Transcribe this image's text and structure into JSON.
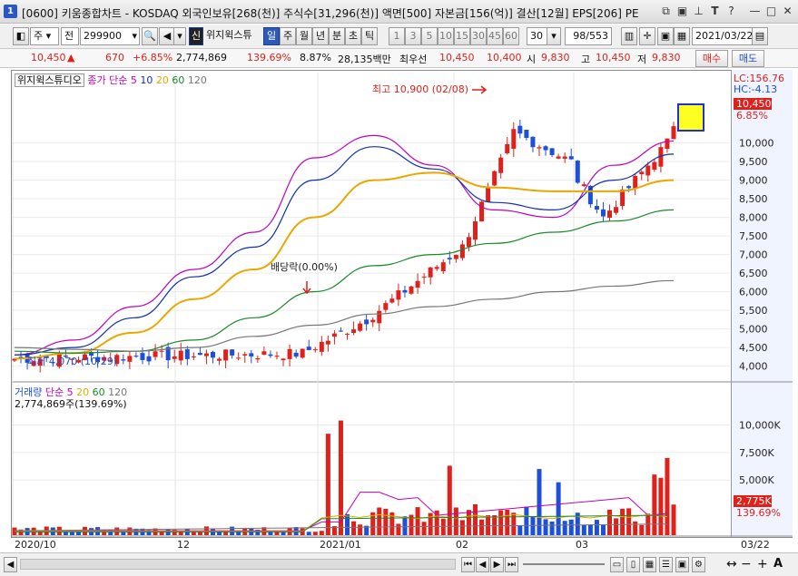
{
  "window": {
    "title": "[0600] 키움종합차트 - KOSDAQ 외국인보유[268(천)] 주식수[31,296(천)] 액면[500] 자본금[156(억)] 결산[12월] EPS[206] PE",
    "icon_label": "1"
  },
  "toolbar": {
    "type1": "주",
    "type2": "전",
    "code": "299900",
    "stock_name": "위지윅스튜",
    "credit_badge": "신",
    "periods": [
      "일",
      "주",
      "월",
      "년",
      "분",
      "초",
      "틱"
    ],
    "active_period": "일",
    "intervals": [
      "1",
      "3",
      "5",
      "10",
      "15",
      "30",
      "45",
      "60"
    ],
    "interval_value": "30",
    "page_count": "98/553",
    "date": "2021/03/22"
  },
  "quote": {
    "price": "10,450",
    "change": "670",
    "change_pct": "+6.85%",
    "volume": "2,774,869",
    "volume_ratio": "139.69%",
    "turnover": "8.87%",
    "trade_value": "28,135백만",
    "best_ask_label": "최우선",
    "best_ask": "10,450",
    "best_bid": "10,400",
    "open_label": "시",
    "open": "9,830",
    "high_label": "고",
    "high": "10,450",
    "low_label": "저",
    "low": "9,830",
    "buy_label": "매수",
    "sell_label": "매도"
  },
  "price_panel": {
    "legend_name": "위지윅스튜디오",
    "legend_ma_label": "종가 단순",
    "legend_periods": [
      "5",
      "10",
      "20",
      "60",
      "120"
    ],
    "lc": "LC:156.76",
    "hc": "HC:-4.13",
    "current_price_tag": "10,450",
    "current_pct_tag": "6.85%",
    "annot_high": "최고 10,900 (02/08)",
    "annot_low": "최저 4,070 (10/29)",
    "annot_dividend": "배당락(0.00%)"
  },
  "volume_panel": {
    "legend_name": "거래량",
    "legend_ma_label": "단순",
    "legend_periods": [
      "5",
      "20",
      "60",
      "120"
    ],
    "value_text": "2,774,869주(139.69%)",
    "current_tag": "2,775K",
    "pct_tag": "139.69%"
  },
  "x_axis": {
    "labels": [
      "2020/10",
      "12",
      "2021/01",
      "02",
      "03"
    ],
    "end_label": "03/22"
  },
  "colors": {
    "up": "#e0201a",
    "down": "#1d4fd8",
    "ma5": "#c000c0",
    "ma10": "#1030b0",
    "ma20": "#e8a800",
    "ma60": "#1a8a2a",
    "ma120": "#777777"
  },
  "chart_data": [
    {
      "type": "candlestick",
      "title": "",
      "ylim": [
        3600,
        11600
      ],
      "yticks": [
        4000,
        4500,
        5000,
        5500,
        6000,
        6500,
        7000,
        7500,
        8000,
        8500,
        9000,
        9500,
        10000
      ],
      "series": [
        {
          "name": "MA5",
          "values": [
            4300,
            4700,
            5600,
            6600,
            7600,
            9600,
            10200,
            9400,
            8200,
            8000,
            9400,
            10050
          ]
        },
        {
          "name": "MA10",
          "values": [
            4300,
            4500,
            5300,
            6400,
            7200,
            9000,
            9900,
            9300,
            8400,
            8200,
            9000,
            9700
          ]
        },
        {
          "name": "MA20",
          "values": [
            4200,
            4350,
            4900,
            5800,
            6600,
            8000,
            9000,
            9200,
            8800,
            8700,
            8700,
            9000
          ]
        },
        {
          "name": "MA60",
          "values": [
            4400,
            4350,
            4400,
            4700,
            5300,
            6000,
            6700,
            7000,
            7300,
            7600,
            7900,
            8200
          ]
        },
        {
          "name": "MA120",
          "values": [
            4500,
            4450,
            4400,
            4500,
            4800,
            5100,
            5400,
            5600,
            5800,
            6000,
            6150,
            6300
          ]
        }
      ],
      "highlights": [
        {
          "label": "최고",
          "value": 10900,
          "date": "02/08"
        },
        {
          "label": "최저",
          "value": 4070,
          "date": "10/29"
        }
      ]
    },
    {
      "type": "bar",
      "title": "",
      "yticks_labels": [
        "5,000K",
        "7,500K",
        "10,000K"
      ],
      "yticks": [
        5000,
        7500,
        10000
      ],
      "ylim": [
        0,
        13000
      ]
    }
  ]
}
